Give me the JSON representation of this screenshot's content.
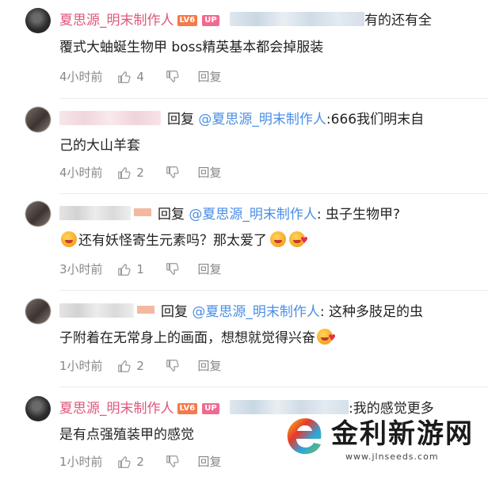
{
  "comments": [
    {
      "username": "夏思源_明末制作人",
      "level": "LV6",
      "up_badge": "UP",
      "text_line1": "有的还有全",
      "text_line2": "覆式大蚰蜒生物甲 boss精英基本都会掉服装",
      "time": "4小时前",
      "likes": "4",
      "reply_label": "回复"
    },
    {
      "reply_word": "回复",
      "mention": "@夏思源_明末制作人",
      "text_line1": ":666我们明末自",
      "text_line2": "己的大山羊套",
      "time": "4小时前",
      "likes": "2",
      "reply_label": "回复"
    },
    {
      "reply_word": "回复",
      "mention": "@夏思源_明末制作人",
      "text_line1": ": 虫子生物甲?",
      "text_line2": "还有妖怪寄生元素吗？那太爱了",
      "time": "3小时前",
      "likes": "1",
      "reply_label": "回复"
    },
    {
      "reply_word": "回复",
      "mention": "@夏思源_明末制作人",
      "text_line1": ": 这种多肢足的虫",
      "text_line2": "子附着在无常身上的画面，想想就觉得兴奋",
      "time": "1小时前",
      "likes": "2",
      "reply_label": "回复"
    },
    {
      "username": "夏思源_明末制作人",
      "level": "LV6",
      "up_badge": "UP",
      "text_line1": ":我的感觉更多",
      "text_line2": "是有点强殖装甲的感觉",
      "time": "1小时前",
      "likes": "2",
      "reply_label": "回复"
    }
  ],
  "icons": {
    "like": "thumbs-up-icon",
    "dislike": "thumbs-down-icon"
  },
  "colors": {
    "username": "#e0577a",
    "mention": "#4a8ee6",
    "meta": "#888888"
  },
  "watermark": {
    "title": "金利新游网",
    "url": "www.jlnseeds.com"
  }
}
